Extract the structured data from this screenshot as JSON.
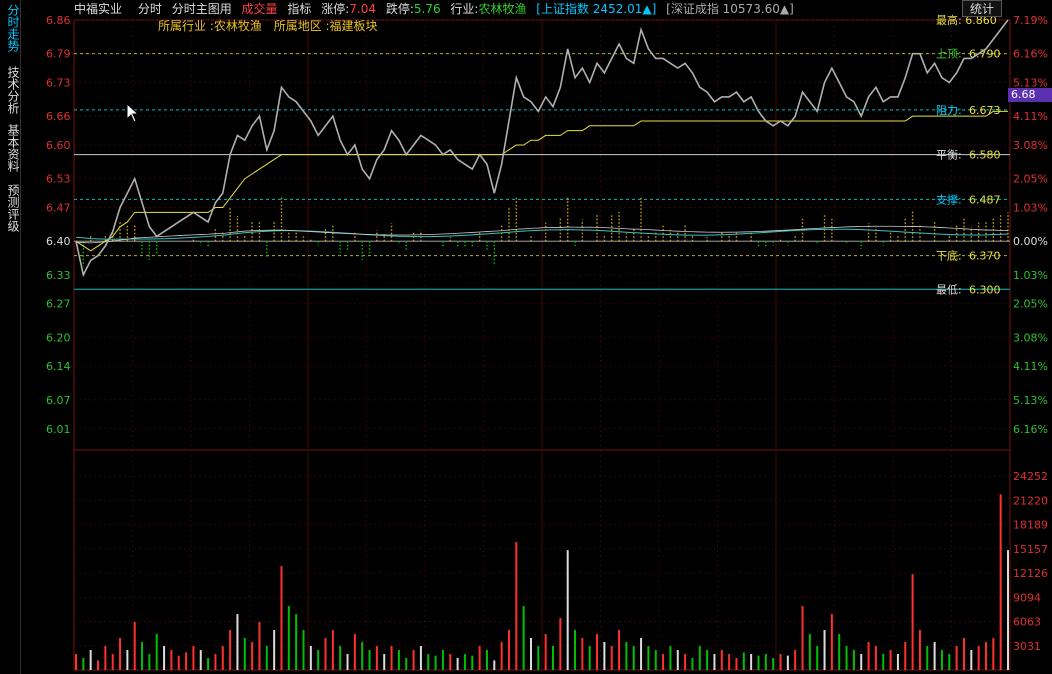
{
  "sidebar": {
    "tabs": [
      {
        "label": "分时走势",
        "active": true
      },
      {
        "label": "技术分析",
        "active": false
      },
      {
        "label": "基本资料",
        "active": false
      },
      {
        "label": "预测评级",
        "active": false
      }
    ]
  },
  "header": {
    "stock_name": "中福实业",
    "menu_timeshare": "分时",
    "menu_main_chart": "分时主图用",
    "menu_volume": "成交量",
    "menu_indicator": "指标",
    "limit_up_label": "涨停:",
    "limit_up_value": "7.04",
    "limit_down_label": "跌停:",
    "limit_down_value": "5.76",
    "industry_label": "行业:",
    "industry_value": "农林牧渔",
    "sh_index": "[上证指数 2452.01▲]",
    "sz_index": "[深证成指 10573.60▲]",
    "stats_button": "统计"
  },
  "sub_header": {
    "industry": "所属行业 :农林牧渔",
    "region": "所属地区 :福建板块"
  },
  "price_tag": "6.68",
  "colors": {
    "up": "#ff3030",
    "down": "#00c000",
    "axis_red": "#e03030",
    "axis_green": "#30c030",
    "price_line": "#b0b0b0",
    "avg_line": "#e8e040",
    "level": "#00c0c0"
  },
  "chart_data": {
    "type": "line",
    "price_axis": {
      "ticks": [
        "6.86",
        "6.79",
        "6.73",
        "6.66",
        "6.60",
        "6.53",
        "6.47",
        "6.40",
        "6.33",
        "6.27",
        "6.20",
        "6.14",
        "6.07",
        "6.01"
      ],
      "prev_close": "6.40",
      "range": [
        5.97,
        6.86
      ]
    },
    "percent_axis": {
      "ticks": [
        "7.19%",
        "6.16%",
        "5.13%",
        "4.11%",
        "3.08%",
        "2.05%",
        "1.03%",
        "0.00%",
        "1.03%",
        "2.05%",
        "3.08%",
        "4.11%",
        "5.13%",
        "6.16%"
      ]
    },
    "volume_axis": {
      "ticks": [
        "24252",
        "21220",
        "18189",
        "15157",
        "12126",
        "9094",
        "6063",
        "3031"
      ],
      "max": 27283
    },
    "levels": [
      {
        "label": "上顶:",
        "value": "6.790",
        "price": 6.79
      },
      {
        "label": "阻力:",
        "value": "6.673",
        "price": 6.673
      },
      {
        "label": "平衡:",
        "value": "6.580",
        "price": 6.58
      },
      {
        "label": "支撑:",
        "value": "6.487",
        "price": 6.487
      },
      {
        "label": "下底:",
        "value": "6.370",
        "price": 6.37
      },
      {
        "label": "最低:",
        "value": "6.300",
        "price": 6.3
      }
    ],
    "top_right_label": "最高: 6.860",
    "price_series": [
      6.4,
      6.33,
      6.36,
      6.37,
      6.39,
      6.42,
      6.47,
      6.5,
      6.53,
      6.48,
      6.43,
      6.41,
      6.42,
      6.43,
      6.44,
      6.45,
      6.46,
      6.45,
      6.44,
      6.48,
      6.5,
      6.58,
      6.62,
      6.61,
      6.64,
      6.66,
      6.59,
      6.63,
      6.72,
      6.7,
      6.69,
      6.67,
      6.65,
      6.62,
      6.64,
      6.66,
      6.61,
      6.58,
      6.6,
      6.55,
      6.53,
      6.57,
      6.59,
      6.63,
      6.61,
      6.58,
      6.6,
      6.62,
      6.61,
      6.6,
      6.58,
      6.59,
      6.57,
      6.56,
      6.55,
      6.58,
      6.56,
      6.5,
      6.56,
      6.65,
      6.74,
      6.7,
      6.69,
      6.67,
      6.7,
      6.68,
      6.72,
      6.8,
      6.74,
      6.76,
      6.73,
      6.77,
      6.75,
      6.78,
      6.81,
      6.78,
      6.77,
      6.84,
      6.8,
      6.78,
      6.78,
      6.77,
      6.76,
      6.77,
      6.75,
      6.72,
      6.71,
      6.69,
      6.7,
      6.7,
      6.71,
      6.69,
      6.7,
      6.67,
      6.65,
      6.64,
      6.65,
      6.64,
      6.66,
      6.71,
      6.69,
      6.67,
      6.73,
      6.76,
      6.73,
      6.7,
      6.69,
      6.66,
      6.7,
      6.72,
      6.69,
      6.7,
      6.7,
      6.74,
      6.79,
      6.79,
      6.75,
      6.77,
      6.74,
      6.73,
      6.75,
      6.78,
      6.78,
      6.79,
      6.8,
      6.82,
      6.84,
      6.86
    ],
    "avg_series": [
      6.4,
      6.39,
      6.38,
      6.39,
      6.4,
      6.41,
      6.43,
      6.44,
      6.46,
      6.46,
      6.46,
      6.46,
      6.46,
      6.46,
      6.46,
      6.46,
      6.46,
      6.46,
      6.46,
      6.47,
      6.47,
      6.49,
      6.51,
      6.53,
      6.54,
      6.55,
      6.56,
      6.57,
      6.58,
      6.58,
      6.58,
      6.58,
      6.58,
      6.58,
      6.58,
      6.58,
      6.58,
      6.58,
      6.58,
      6.58,
      6.58,
      6.58,
      6.58,
      6.58,
      6.58,
      6.58,
      6.58,
      6.58,
      6.58,
      6.58,
      6.58,
      6.58,
      6.58,
      6.58,
      6.58,
      6.58,
      6.58,
      6.58,
      6.58,
      6.59,
      6.6,
      6.6,
      6.61,
      6.61,
      6.62,
      6.62,
      6.62,
      6.63,
      6.63,
      6.63,
      6.64,
      6.64,
      6.64,
      6.64,
      6.64,
      6.64,
      6.64,
      6.65,
      6.65,
      6.65,
      6.65,
      6.65,
      6.65,
      6.65,
      6.65,
      6.65,
      6.65,
      6.65,
      6.65,
      6.65,
      6.65,
      6.65,
      6.65,
      6.65,
      6.65,
      6.65,
      6.65,
      6.65,
      6.65,
      6.65,
      6.65,
      6.65,
      6.65,
      6.65,
      6.65,
      6.65,
      6.65,
      6.65,
      6.65,
      6.65,
      6.65,
      6.65,
      6.65,
      6.65,
      6.66,
      6.66,
      6.66,
      6.66,
      6.66,
      6.66,
      6.66,
      6.66,
      6.66,
      6.66,
      6.66,
      6.67,
      6.67,
      6.67
    ],
    "volume_series": [
      2000,
      1500,
      2500,
      1200,
      3000,
      2000,
      4000,
      2500,
      6000,
      3500,
      2000,
      4500,
      3000,
      2500,
      1800,
      2200,
      3000,
      2500,
      1500,
      2000,
      3000,
      5000,
      7000,
      4000,
      3500,
      6000,
      3000,
      5000,
      13000,
      8000,
      7000,
      5000,
      3000,
      2500,
      4000,
      5000,
      3000,
      2000,
      4500,
      3500,
      2500,
      3000,
      2000,
      3000,
      2500,
      1500,
      2500,
      3000,
      2000,
      1800,
      2500,
      2000,
      1500,
      2000,
      1800,
      3000,
      2500,
      1200,
      3500,
      5000,
      16000,
      8000,
      4000,
      3000,
      4500,
      3000,
      6500,
      15000,
      5000,
      4000,
      3000,
      4500,
      3500,
      3000,
      5000,
      3500,
      3000,
      4000,
      3000,
      2500,
      2000,
      3000,
      2500,
      2000,
      1500,
      3000,
      2500,
      2000,
      2500,
      2000,
      1500,
      2200,
      2000,
      1800,
      2000,
      1500,
      2000,
      1800,
      2500,
      8000,
      4500,
      3000,
      5000,
      7000,
      4500,
      3000,
      2500,
      2000,
      3500,
      3000,
      2000,
      2500,
      2000,
      3500,
      12000,
      5000,
      3000,
      3500,
      2500,
      2000,
      3000,
      4000,
      2500,
      3000,
      3500,
      4000,
      22000,
      15000
    ]
  }
}
